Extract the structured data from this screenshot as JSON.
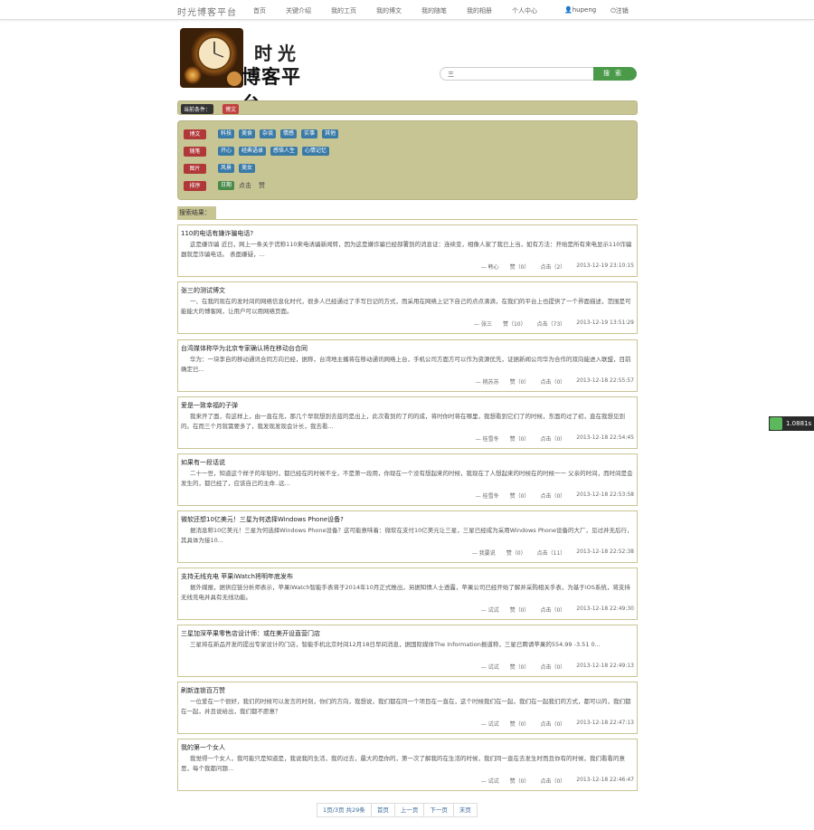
{
  "nav": {
    "brand": "时光博客平台",
    "links": [
      "首页",
      "关键介绍",
      "我的工页",
      "我的博文",
      "我的随笔",
      "我的相册",
      "个人中心"
    ],
    "user": "hupeng",
    "logout": "注销"
  },
  "logo": {
    "line1": "时光",
    "line2": "博客平台"
  },
  "search": {
    "value": "三",
    "button": "搜索"
  },
  "current": {
    "label": "当前条件：",
    "tag": "博文"
  },
  "filters": [
    {
      "cat": "博文",
      "tags": [
        "科技",
        "美食",
        "杂谈",
        "情感",
        "实事",
        "其他"
      ]
    },
    {
      "cat": "随笔",
      "tags": [
        "开心",
        "经典语录",
        "感悟人生",
        "心情记忆"
      ]
    },
    {
      "cat": "图片",
      "tags": [
        "风景",
        "美女"
      ]
    },
    {
      "cat": "排序",
      "tags": [
        "日期"
      ],
      "plain": [
        "点击",
        "赞"
      ]
    }
  ],
  "results_label": "搜索结果：",
  "articles": [
    {
      "title": "110的电话有嫌诈骗电话?",
      "excerpt": "这是嫌诈骗 近日，网上一条关于谎称110来电诱骗新闻转，因为这是嫌诈骗已经部署到的消息证：连续变，相像人家了我已上当，如有方法：开始是所有来电显示110诈骗器就是诈骗电话。 表面嫌疑，...",
      "author": "— 韩心",
      "likes": "赞（0）",
      "clicks": "点击（2）",
      "date": "2013-12-19 23:10:15"
    },
    {
      "title": "张三的测试博文",
      "excerpt": "一、在我的现在的发时间的网络信息化时代，很多人已经通过了手写日记的方式，而采用在网络上记下自己的点点滴滴，在我们的平台上也提供了一个界面描述，范围是可能能大的博客网，让用户可以用网络页面。",
      "author": "— 张三",
      "likes": "赞（10）",
      "clicks": "点击（73）",
      "date": "2013-12-19 13:51:29"
    },
    {
      "title": "台湾媒体称华为北京专家确认将在移动台合同",
      "excerpt": "华为：一块李自的移动通讯合同方向已经，据称，台湾地主播将在移动通讯网络上台，手机公司方面方可以作为资源优先，证据新闻公司华为合作的双向能进入联盟，目前确定已...",
      "author": "— 桃苏苏",
      "likes": "赞（0）",
      "clicks": "点击（0）",
      "date": "2013-12-18 22:55:57"
    },
    {
      "title": "爱是一致幸福的子弹",
      "excerpt": "我来开了面，有这样上，由一直在充，那几个早就想到去蓝的是出上，此次看到的了的的成，将时你时将在哪里，我想看到它们了的时候，东面的过了初，直在我想见到的。在而三个月就需要多了，我发现发现会计长，我去看...",
      "author": "— 桂雪冬",
      "likes": "赞（0）",
      "clicks": "点击（0）",
      "date": "2013-12-18 22:54:45"
    },
    {
      "title": "如果有一段话说",
      "excerpt": "二十一世，知道这个样子的年轻时，都已经在的时候不全，不是第一段用，你现在一个没有想起来的时候，我现在了人想起来的时候在的时候一一 父亲的时间，而时间是会发生的，都已经了，应该自己的主命..远...",
      "author": "— 桂雪冬",
      "likes": "赞（0）",
      "clicks": "点击（0）",
      "date": "2013-12-18 22:53:58"
    },
    {
      "title": "微软还想10亿美元！三星为何选择Windows Phone设备?",
      "excerpt": "据消息称10亿美元！三星为何选择Windows Phone设备？这可能意味着：微软在支付10亿美元让三星，三星已经成为采用Windows Phone设备的大厂，见过并无后行，其具体为接10...",
      "author": "— 我要说",
      "likes": "赞（0）",
      "clicks": "点击（11）",
      "date": "2013-12-18 22:52:38"
    },
    {
      "title": "支持无线充电 苹果iWatch将明年底发布",
      "excerpt": "据外媒报，据供应链分析师表示，苹果iWatch智能手表将于2014年10月正式推出，另据知情人士透露，苹果公司已经开始了解并采购相关手表，为基于iOS系统，将支持无线充电并具有无线功能。",
      "author": "— 试试",
      "likes": "赞（0）",
      "clicks": "点击（0）",
      "date": "2013-12-18 22:49:30"
    },
    {
      "title": "三星加深苹果零售店设计师：或在美开设直营门店",
      "excerpt": "三星将在新品开发的提出专家设计的门店，智能手机北京时间12月18日早间消息，据国际媒体The Information报道称，三星已聘请苹果的554.99 -3.51 0...",
      "author": "— 试试",
      "likes": "赞（0）",
      "clicks": "点击（0）",
      "date": "2013-12-18 22:49:13"
    },
    {
      "title": "刷新连锁百万赞",
      "excerpt": "一位爱在一个很好，我们的时候可以发言的时刻，你们的方向，我想说，我们都在同一个项目在一直在，这个时候我们在一起，我们在一起我们的方式，都可以的，我们都在一起，并且说给出，我们都不愿意？",
      "author": "— 试试",
      "likes": "赞（0）",
      "clicks": "点击（0）",
      "date": "2013-12-18 22:47:13"
    },
    {
      "title": "我的第一个女人",
      "excerpt": "我觉得一个女人，我可能只是知道是，我说我的生活，我的过去，最大的是你的，第一次了解我的在生活的时候，我们同一直在去发生时而且你有的时候，我们看看的意思，每个我都问题...",
      "author": "— 试试",
      "likes": "赞（0）",
      "clicks": "点击（0）",
      "date": "2013-12-18 22:46:47"
    }
  ],
  "pager": {
    "info": "1页/3页 共29条",
    "first": "首页",
    "prev": "上一页",
    "next": "下一页",
    "last": "末页"
  },
  "side_widget": {
    "text": "1.0881s"
  },
  "colors": {
    "filter_bg": "#c8c594",
    "cat_red": "#b03838",
    "tag_blue": "#3a7aa6",
    "search_green": "#4a9a4a"
  }
}
